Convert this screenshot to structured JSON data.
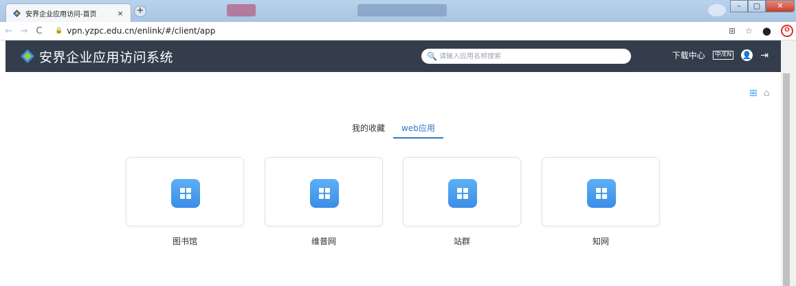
{
  "browser": {
    "tab_title": "安界企业应用访问-首页",
    "tab_close": "×",
    "new_tab": "+",
    "url": "vpn.yzpc.edu.cn/enlink/#/client/app",
    "back_icon": "←",
    "forward_icon": "→",
    "reload_icon": "C"
  },
  "header": {
    "title": "安界企业应用访问系统",
    "search_placeholder": "请输入应用名称搜索",
    "download_center": "下载中心",
    "language": "中/EN",
    "bg_color": "#333d4b"
  },
  "tabs": [
    {
      "label": "我的收藏",
      "active": false
    },
    {
      "label": "web应用",
      "active": true
    }
  ],
  "apps": [
    {
      "name": "图书馆",
      "icon": "app-grid-icon"
    },
    {
      "name": "维普网",
      "icon": "app-grid-icon"
    },
    {
      "name": "站群",
      "icon": "app-grid-icon"
    },
    {
      "name": "知网",
      "icon": "app-grid-icon"
    }
  ],
  "accent_color": "#2e77c8"
}
